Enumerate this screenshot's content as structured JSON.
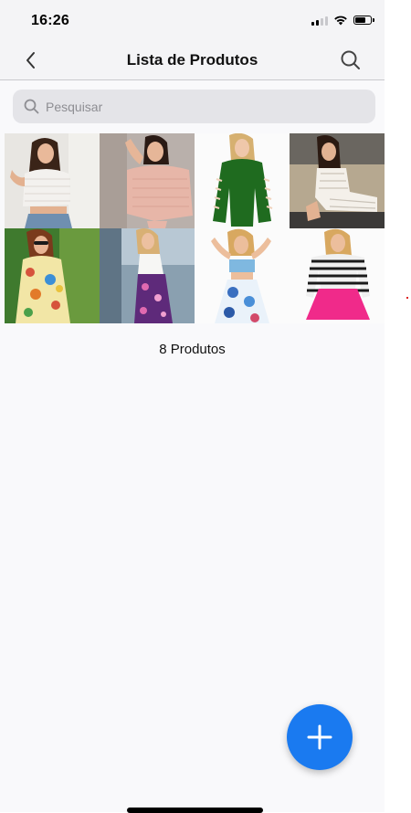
{
  "status_bar": {
    "time": "16:26"
  },
  "nav": {
    "title": "Lista de Produtos",
    "back_icon": "chevron-left-icon",
    "search_icon": "search-icon"
  },
  "search": {
    "placeholder": "Pesquisar",
    "value": ""
  },
  "products": [
    {
      "kind": "white-knit-crop-top-jeans",
      "bg": "#e8e6e2"
    },
    {
      "kind": "pink-knit-sweater",
      "bg": "#b9b0ab"
    },
    {
      "kind": "green-cutout-sweater",
      "bg": "#fbfbfb"
    },
    {
      "kind": "striped-white-dress-seated",
      "bg": "#3c3a38"
    },
    {
      "kind": "floral-dress-sunglasses",
      "bg": "#3f7a2e"
    },
    {
      "kind": "white-top-purple-floral-pants",
      "bg": "#8aa0b0"
    },
    {
      "kind": "crop-top-floral-skirt",
      "bg": "#fbfbfb"
    },
    {
      "kind": "striped-top-pink-skirt",
      "bg": "#fbfbfb"
    }
  ],
  "footer": {
    "count_label": "8 Produtos"
  },
  "fab": {
    "icon": "plus-icon",
    "color": "#1a7af0"
  }
}
